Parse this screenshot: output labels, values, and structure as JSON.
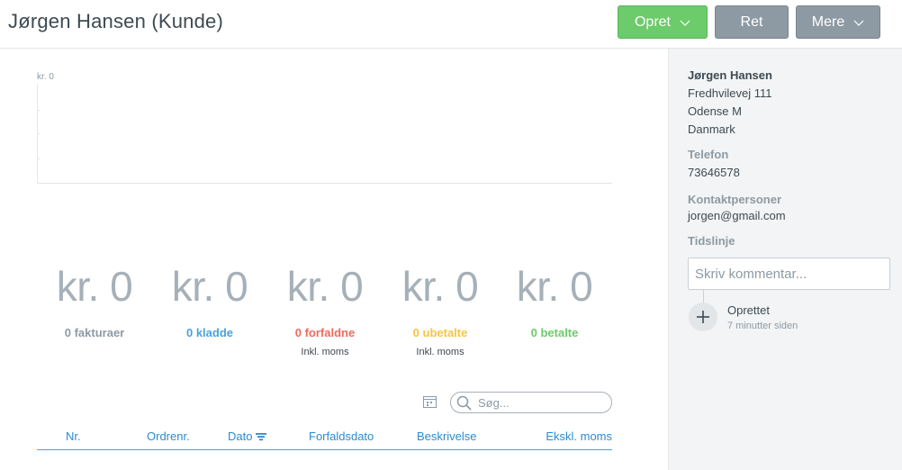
{
  "header": {
    "title": "Jørgen Hansen (Kunde)",
    "buttons": {
      "create": "Opret",
      "edit": "Ret",
      "more": "Mere"
    }
  },
  "chart": {
    "y_label": "kr. 0"
  },
  "chart_data": {
    "type": "bar",
    "ylabel": "kr. 0",
    "values": [],
    "grid": true
  },
  "stats": [
    {
      "value": "kr. 0",
      "label": "0 fakturaer",
      "sub": "",
      "color": "#8d9aa4"
    },
    {
      "value": "kr. 0",
      "label": "0 kladde",
      "sub": "",
      "color": "#4aa3df"
    },
    {
      "value": "kr. 0",
      "label": "0 forfaldne",
      "sub": "Inkl. moms",
      "color": "#f06a5f"
    },
    {
      "value": "kr. 0",
      "label": "0 ubetalte",
      "sub": "Inkl. moms",
      "color": "#f6c544"
    },
    {
      "value": "kr. 0",
      "label": "0 betalte",
      "sub": "",
      "color": "#6ccb6a"
    }
  ],
  "search": {
    "placeholder": "Søg..."
  },
  "table": {
    "columns": [
      "Nr.",
      "Ordrenr.",
      "Dato",
      "Forfaldsdato",
      "Beskrivelse",
      "Ekskl. moms"
    ]
  },
  "sidebar": {
    "name": "Jørgen Hansen",
    "address": [
      "Fredhvilevej 111",
      "Odense M",
      "Danmark"
    ],
    "phone_label": "Telefon",
    "phone": "73646578",
    "contacts_label": "Kontaktpersoner",
    "contact_email": "jorgen@gmail.com",
    "timeline_label": "Tidslinje",
    "comment_placeholder": "Skriv kommentar...",
    "timeline": {
      "title": "Oprettet",
      "time": "7 minutter siden"
    }
  },
  "icons": {
    "chevron": "chevron-down-icon",
    "calendar": "calendar-icon",
    "search": "search-icon",
    "sort": "sort-icon",
    "plus": "plus-icon"
  }
}
